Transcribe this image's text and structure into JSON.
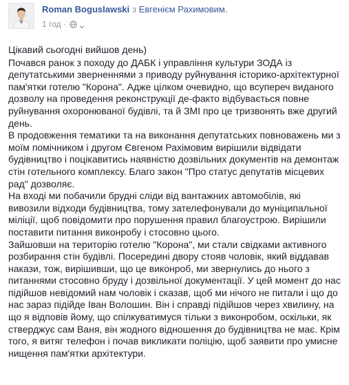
{
  "header": {
    "author_name": "Roman Boguslawski",
    "with_word": "з",
    "tagged_person": "Евгенієм Рахимовим.",
    "time": "1 год",
    "separator": "·"
  },
  "icons": {
    "audience": "globe-icon",
    "audience_menu": "chevron-down-icon"
  },
  "colors": {
    "link": "#365899",
    "meta": "#90949c",
    "text": "#1d2129"
  },
  "post": {
    "paragraphs": [
      "Цікавий сьогодні вийшов день)",
      "Почався ранок з походу до ДАБК і управління культури ЗОДА із депутатськими зверненнями з приводу руйнування історико-архітектурної пам'ятки готелю \"Корона\". Адже цілком очевидно, що всупереч виданого дозволу на проведення реконструкції де-факто відбувається повне руйнування охоронюваної будівлі, та й ЗМІ про це тризвонять вже другий день.",
      "В продовження тематики та на виконання депутатських повноважень ми з моїм помічником і другом Євгеном Рахімовим вирішили відвідати будівництво і поцікавитись наявністю дозвільних документів на демонтаж стін готельного комплексу. Благо закон \"Про статус депутатів місцевих рад\" дозволяє.",
      "На вході ми побачили брудні сліди від вантажних автомобілів, які вивозили відходи будівництва, тому зателефонували до муніципальної міліції, щоб повідомити про порушення правил благоустрою. Вирішили поставити питання виконробу і стосовно цього.",
      "Зайшовши на територію готелю \"Корона\", ми стали свідками активного розбирання стін будівлі. Посередині двору стояв чоловік, який віддавав накази, тож, вирішивши, що це виконроб, ми звернулись до нього з питаннями стосовно бруду і дозвільної документації. У цей момент до нас підійшов невідомий нам чоловік і сказав, щоб ми нічого не питали і що до нас зараз підійде Іван Волошин. Він і справді підійшов через хвилину, на що я відповів йому, що спілкуватимуся тільки з виконробом, оскільки, як стверджує сам Ваня, він жодного відношення до будівництва не має. Крім того, я витяг телефон і почав викликати поліцію, щоб заявити про умисне нищення пам'ятки архітектури."
    ]
  }
}
